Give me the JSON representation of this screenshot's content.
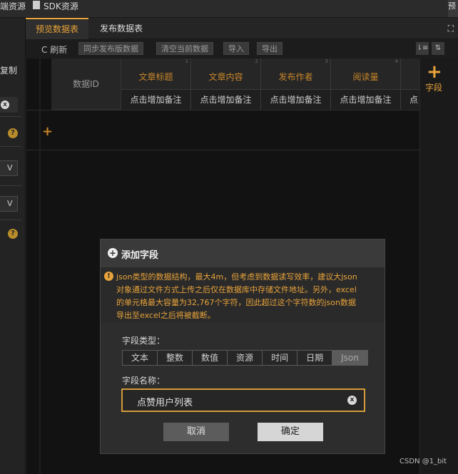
{
  "topbar": {
    "item1": "端资源",
    "item2": "SDK资源"
  },
  "left": {
    "copy_label": "复制",
    "help": "?",
    "select_arrow": "V",
    "clear": "x"
  },
  "tabs": {
    "preview": "预览数据表",
    "publish": "发布数据表",
    "expand_icon": "⛶"
  },
  "toolbar": {
    "refresh": "C 刷新",
    "sync": "同步发布版数据",
    "clear_current": "清空当前数据",
    "import": "导入",
    "export": "导出",
    "sort_asc": "⇂≡",
    "sort_desc": "⇅"
  },
  "grid": {
    "id_header": "数据ID",
    "columns": [
      {
        "title": "文章标题",
        "note": "点击增加备注",
        "idx": "1"
      },
      {
        "title": "文章内容",
        "note": "点击增加备注",
        "idx": "2"
      },
      {
        "title": "发布作者",
        "note": "点击增加备注",
        "idx": "3"
      },
      {
        "title": "阅读量",
        "note": "点击增加备注",
        "idx": "4"
      },
      {
        "title": "",
        "note": "点击",
        "idx": ""
      }
    ],
    "add_row": "+"
  },
  "rail": {
    "plus": "+",
    "label": "字段"
  },
  "dialog": {
    "title": "添加字段",
    "warning_lines": [
      "json类型的数据结构，最大4m，但考虑到数据读写效率，建议大json",
      "对象通过文件方式上传之后仅在数据库中存储文件地址。另外，excel",
      "的单元格最大容量为32,767个字符，因此超过这个字符数的json数据",
      "导出至excel之后将被截断。"
    ],
    "type_label": "字段类型：",
    "types": [
      "文本",
      "整数",
      "数值",
      "资源",
      "时间",
      "日期",
      "Json"
    ],
    "selected_type": "Json",
    "name_label": "字段名称：",
    "name_value": "点赞用户列表",
    "cancel": "取消",
    "confirm": "确定"
  },
  "watermark": "CSDN @1_bit",
  "colors": {
    "accent": "#e8a33a",
    "bg": "#141414"
  }
}
